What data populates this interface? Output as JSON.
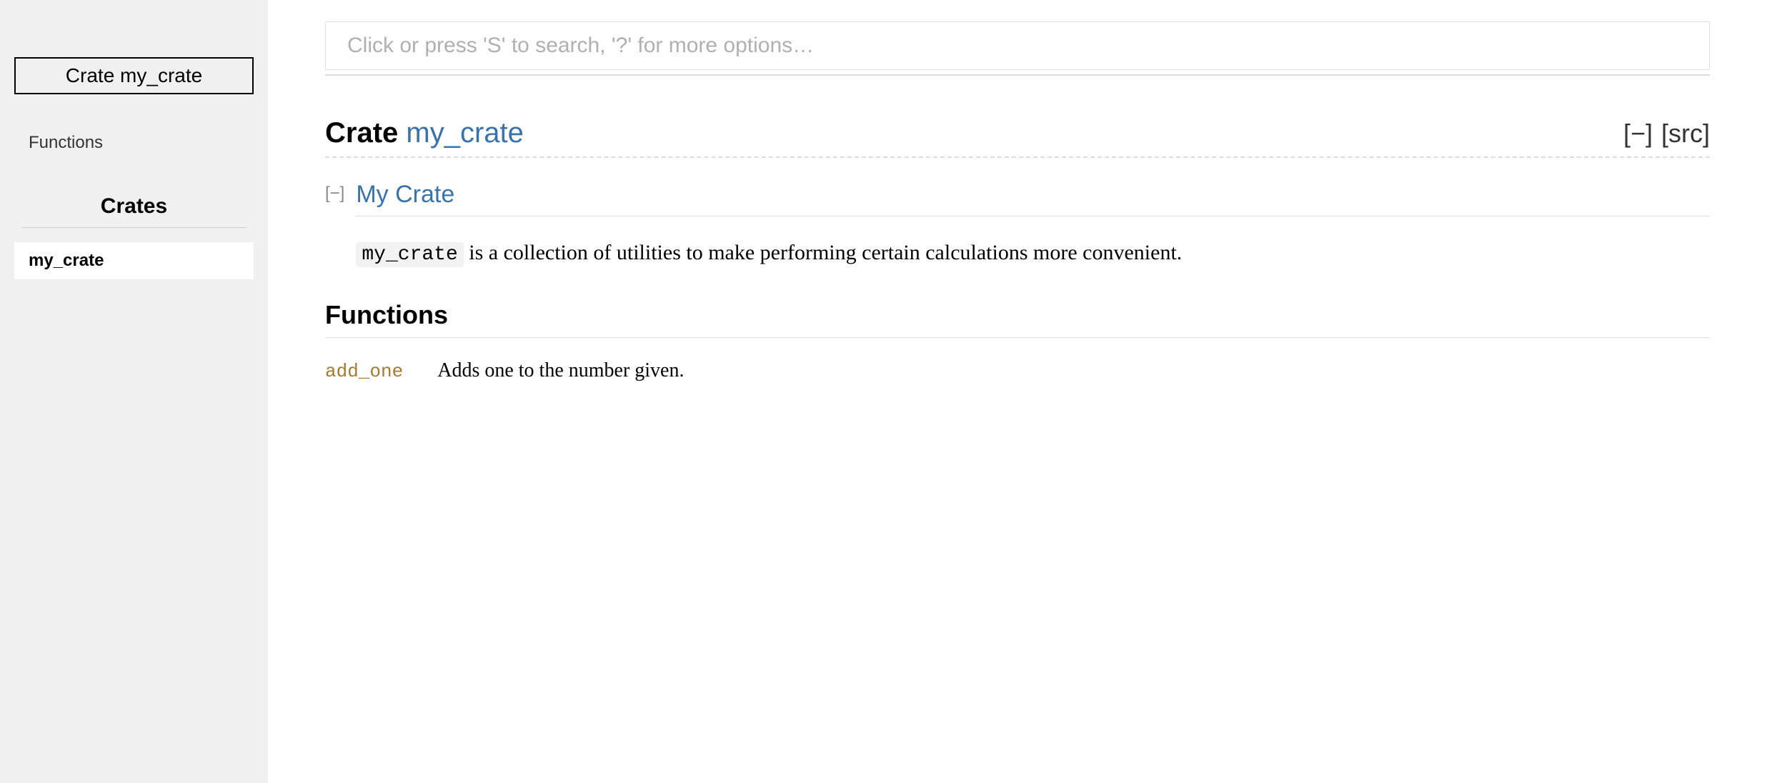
{
  "sidebar": {
    "title": "Crate my_crate",
    "section_link": "Functions",
    "crates_heading": "Crates",
    "crate_item": "my_crate"
  },
  "search": {
    "placeholder": "Click or press 'S' to search, '?' for more options…"
  },
  "header": {
    "kind": "Crate ",
    "name": "my_crate",
    "collapse": "[−]",
    "src": "[src]"
  },
  "doc": {
    "toggle": "[−]",
    "heading": "My Crate",
    "code": "my_crate",
    "description_rest": " is a collection of utilities to make performing certain calculations more convenient."
  },
  "section": {
    "functions_heading": "Functions"
  },
  "functions": [
    {
      "name": "add_one",
      "desc": "Adds one to the number given."
    }
  ]
}
